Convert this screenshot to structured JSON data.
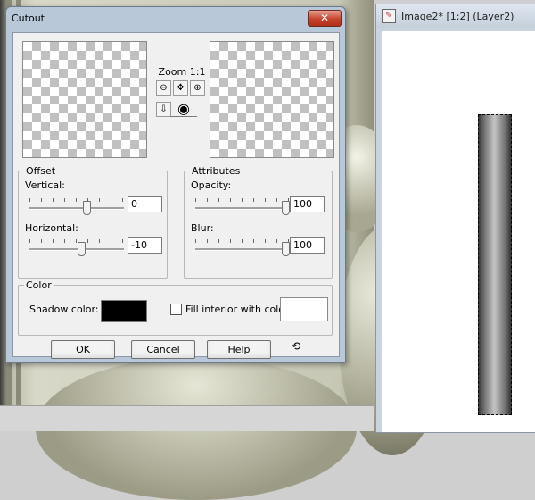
{
  "dialog": {
    "title": "Cutout",
    "close_glyph": "✕",
    "zoom_label": "Zoom 1:1",
    "zoom_icons": [
      "zoom-out-icon",
      "pan-icon",
      "zoom-in-icon",
      "proof-icon",
      "eye-icon"
    ],
    "offset": {
      "legend": "Offset",
      "vertical_label": "Vertical:",
      "vertical_value": "0",
      "horizontal_label": "Horizontal:",
      "horizontal_value": "-10"
    },
    "attributes": {
      "legend": "Attributes",
      "opacity_label": "Opacity:",
      "opacity_value": "100",
      "blur_label": "Blur:",
      "blur_value": "100"
    },
    "color": {
      "legend": "Color",
      "shadow_label": "Shadow color:",
      "shadow_color": "#000000",
      "fill_label": "Fill interior with color:",
      "fill_checked": false,
      "fill_color": "#ffffff"
    },
    "buttons": {
      "ok": "OK",
      "cancel": "Cancel",
      "help": "Help"
    }
  },
  "image_window": {
    "title": "Image2* [1:2] (Layer2)"
  }
}
